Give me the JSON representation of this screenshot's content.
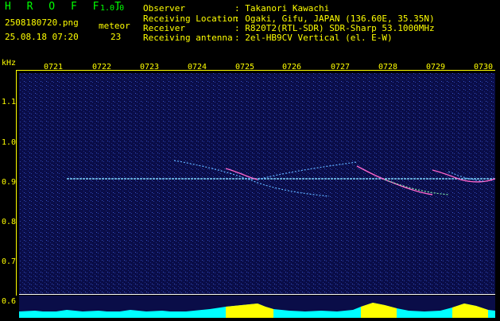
{
  "app": {
    "title": "H R O F F T",
    "version": "1.0.0",
    "filename": "2508180720.png",
    "datetime": "25.08.18 07:20",
    "meteor_label": "meteor",
    "meteor_count": "23"
  },
  "info": {
    "observer_label": "Observer",
    "observer_value": ": Takanori Kawachi",
    "location_label": "Receiving Location",
    "location_value": ": Ogaki, Gifu, JAPAN (136.60E, 35.35N)",
    "receiver_label": "Receiver",
    "receiver_value": ": R820T2(RTL-SDR) SDR-Sharp 53.1000MHz",
    "antenna_label": "Receiving antenna",
    "antenna_value": ": 2el-HB9CV Vertical (el. E-W)"
  },
  "axes": {
    "y_unit": "kHz",
    "y_ticks": [
      "1.1",
      "1.0",
      "0.9",
      "0.8",
      "0.7",
      "0.6"
    ],
    "x_ticks": [
      "0721",
      "0722",
      "0723",
      "0724",
      "0725",
      "0726",
      "0727",
      "0728",
      "0729",
      "0730"
    ]
  },
  "colors": {
    "background": "#000000",
    "plot_bg": "#0a0d48",
    "label": "#ffff00",
    "title": "#00ff00",
    "carrier": "#7fd8ff",
    "meter": "#00ffff"
  }
}
